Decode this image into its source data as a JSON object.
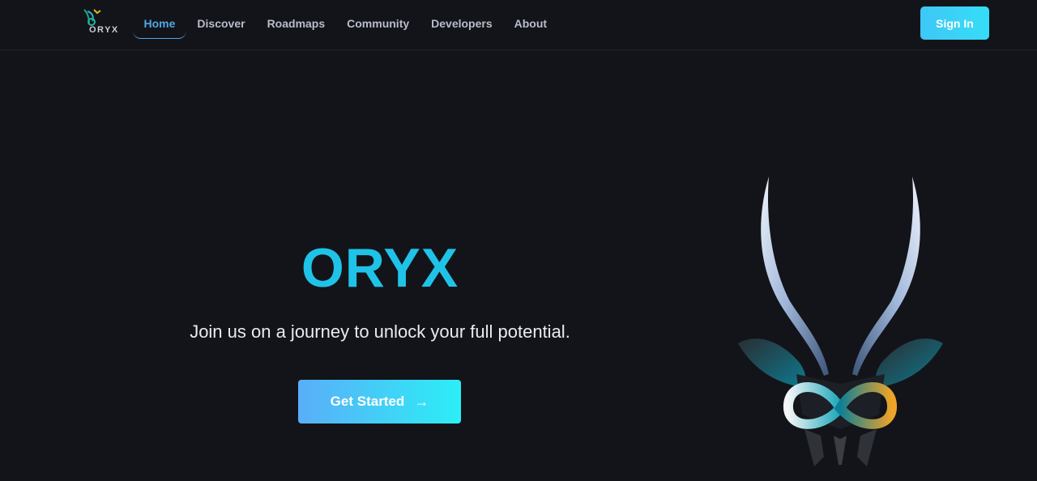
{
  "header": {
    "logo_text": "ORYX",
    "nav": [
      {
        "label": "Home",
        "active": true
      },
      {
        "label": "Discover"
      },
      {
        "label": "Roadmaps"
      },
      {
        "label": "Community"
      },
      {
        "label": "Developers"
      },
      {
        "label": "About"
      }
    ],
    "signin_label": "Sign In"
  },
  "hero": {
    "title": "ORYX",
    "subtitle": "Join us on a journey to unlock your full potential.",
    "cta_label": "Get Started",
    "cta_icon": "arrow-right-icon"
  },
  "colors": {
    "background": "#131419",
    "accent": "#1fc3e8",
    "nav_active": "#4ea8e6",
    "button_gradient_start": "#5aaef8",
    "button_gradient_end": "#2ceef6"
  }
}
